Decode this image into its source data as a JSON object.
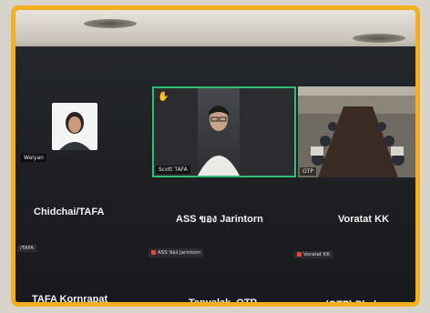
{
  "participants": {
    "tile_avatar_name": "Waiyan",
    "speaker_name": "Scott TAFA",
    "room_name": "OTP",
    "row1": [
      "Chidchai/TAFA",
      "ASS ของ Jarintorn",
      "Voratat KK"
    ],
    "row1_small_left": "/TAFA",
    "row1_small_mid": "ASS ของ Jarintorn",
    "row1_small_right": "Voratat KK",
    "row2": [
      "TAFA Kornrapat",
      "Tanyalak_OTP",
      "(OTP) Phakwan..."
    ]
  }
}
